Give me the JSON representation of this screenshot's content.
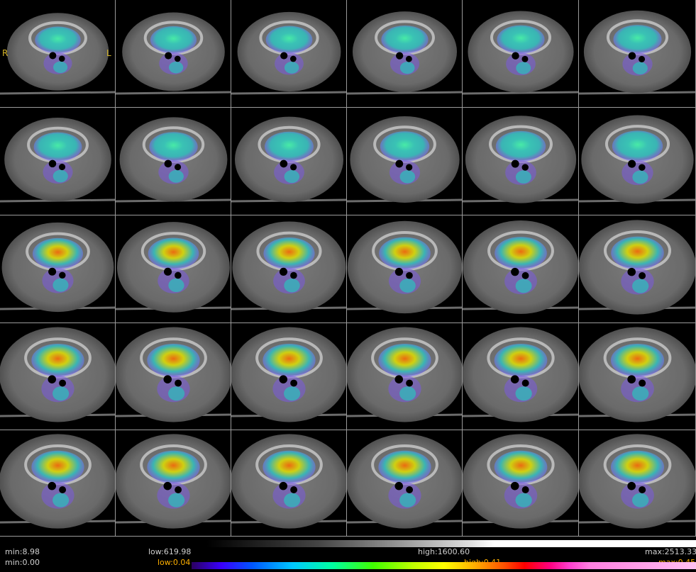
{
  "viewer": {
    "orientation_right": "R",
    "orientation_left": "L",
    "grid": {
      "rows": 5,
      "cols": 6
    }
  },
  "footer": {
    "ct": {
      "min": "min:8.98",
      "low": "low:619.98",
      "high": "high:1600.60",
      "max": "max:2513.33"
    },
    "pet": {
      "min": "min:0.00",
      "low": "low:0.04",
      "high": "high:0.41",
      "max": "max:0.45"
    }
  },
  "colors": {
    "label_gray": "#cfcfcf",
    "label_orange": "#ffb000",
    "orientation": "#d7b62a"
  }
}
